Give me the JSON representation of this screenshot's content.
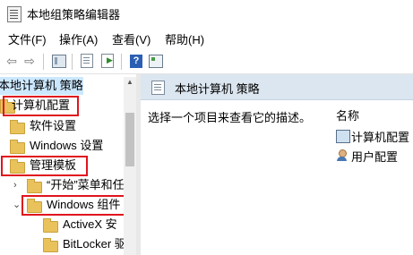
{
  "window": {
    "title": "本地组策略编辑器"
  },
  "menu": [
    {
      "label": "文件(F)"
    },
    {
      "label": "操作(A)"
    },
    {
      "label": "查看(V)"
    },
    {
      "label": "帮助(H)"
    }
  ],
  "toolbar": {
    "icons": [
      "back-arrow-icon",
      "forward-arrow-icon",
      "show-hide-tree-icon",
      "list-icon",
      "export-icon",
      "help-icon",
      "properties-icon"
    ],
    "help_glyph": "?"
  },
  "tree": {
    "root_label": "本地计算机 策略",
    "items": [
      {
        "label": "计算机配置"
      },
      {
        "label": "软件设置"
      },
      {
        "label": "Windows 设置"
      },
      {
        "label": "管理模板"
      },
      {
        "label": "“开始”菜单和任"
      },
      {
        "label": "Windows 组件"
      },
      {
        "label": "ActiveX 安"
      },
      {
        "label": "BitLocker 驱"
      }
    ]
  },
  "right_pane": {
    "header_title": "本地计算机 策略",
    "description": "选择一个项目来查看它的描述。",
    "column_header": "名称",
    "entries": [
      {
        "label": "计算机配置"
      },
      {
        "label": "用户配置"
      }
    ]
  },
  "colors": {
    "highlight": "#e0141e",
    "folder": "#e9c25b",
    "header_bg": "#dce6f0"
  }
}
